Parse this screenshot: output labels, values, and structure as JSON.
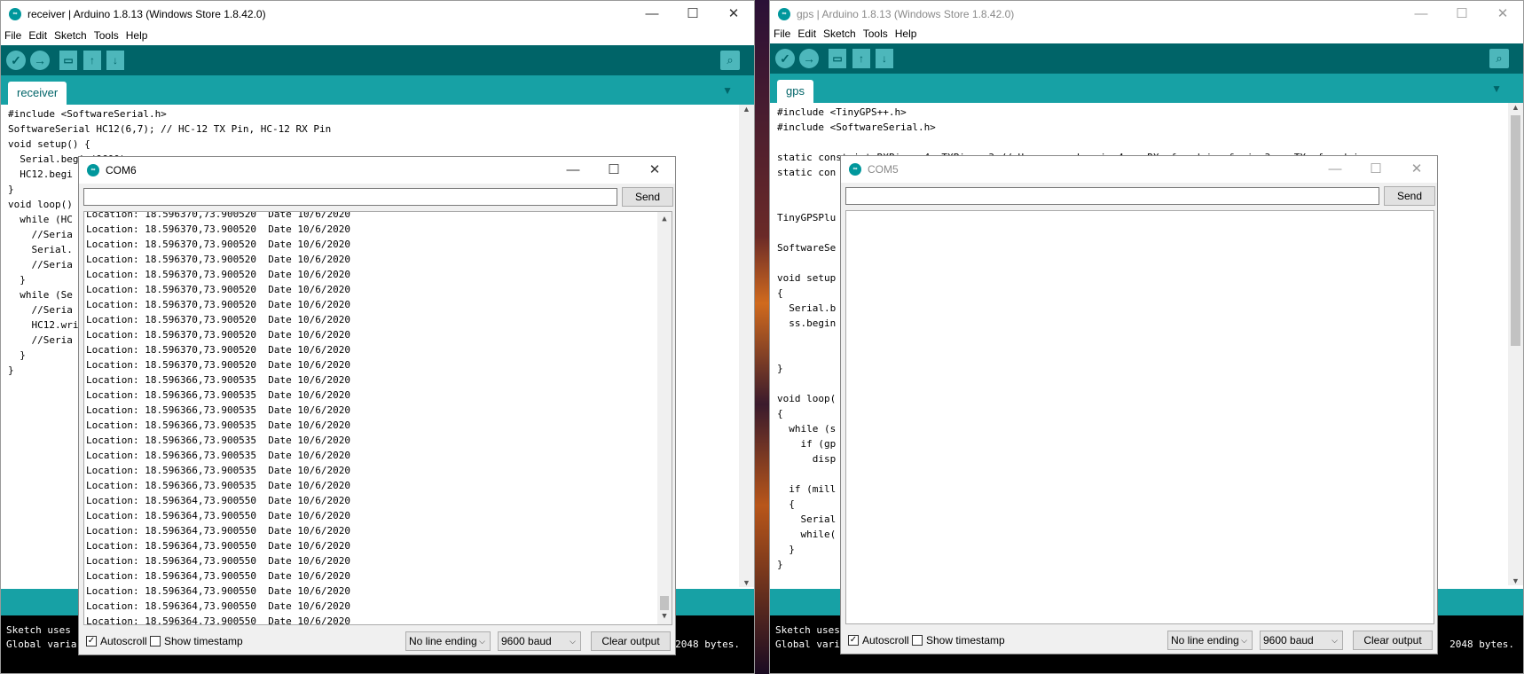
{
  "left_window": {
    "title": "receiver | Arduino 1.8.13 (Windows Store 1.8.42.0)",
    "menus": [
      "File",
      "Edit",
      "Sketch",
      "Tools",
      "Help"
    ],
    "tab": "receiver",
    "code_lines": [
      "#include <SoftwareSerial.h>",
      "SoftwareSerial HC12(6,7); // HC-12 TX Pin, HC-12 RX Pin",
      "void setup() {",
      "  Serial.begin(9600);",
      "  HC12.begi",
      "}",
      "void loop()",
      "  while (HC",
      "    //Seria",
      "    Serial.",
      "    //Seria",
      "  }",
      "  while (Se",
      "    //Seria",
      "    HC12.wri",
      "    //Seria",
      "  }",
      "}"
    ],
    "console_lines": [
      "Sketch uses",
      "Global varia"
    ]
  },
  "left_serial": {
    "title": "COM6",
    "send_label": "Send",
    "output_lines": [
      "Location: 18.596370,73.900520  Date 10/6/2020",
      "Location: 18.596370,73.900520  Date 10/6/2020",
      "Location: 18.596370,73.900520  Date 10/6/2020",
      "Location: 18.596370,73.900520  Date 10/6/2020",
      "Location: 18.596370,73.900520  Date 10/6/2020",
      "Location: 18.596370,73.900520  Date 10/6/2020",
      "Location: 18.596370,73.900520  Date 10/6/2020",
      "Location: 18.596370,73.900520  Date 10/6/2020",
      "Location: 18.596370,73.900520  Date 10/6/2020",
      "Location: 18.596370,73.900520  Date 10/6/2020",
      "Location: 18.596370,73.900520  Date 10/6/2020",
      "Location: 18.596366,73.900535  Date 10/6/2020",
      "Location: 18.596366,73.900535  Date 10/6/2020",
      "Location: 18.596366,73.900535  Date 10/6/2020",
      "Location: 18.596366,73.900535  Date 10/6/2020",
      "Location: 18.596366,73.900535  Date 10/6/2020",
      "Location: 18.596366,73.900535  Date 10/6/2020",
      "Location: 18.596366,73.900535  Date 10/6/2020",
      "Location: 18.596366,73.900535  Date 10/6/2020",
      "Location: 18.596364,73.900550  Date 10/6/2020",
      "Location: 18.596364,73.900550  Date 10/6/2020",
      "Location: 18.596364,73.900550  Date 10/6/2020",
      "Location: 18.596364,73.900550  Date 10/6/2020",
      "Location: 18.596364,73.900550  Date 10/6/2020",
      "Location: 18.596364,73.900550  Date 10/6/2020",
      "Location: 18.596364,73.900550  Date 10/6/2020",
      "Location: 18.596364,73.900550  Date 10/6/2020",
      "Location: 18.596364,73.900550  Date 10/6/2020"
    ],
    "autoscroll_label": "Autoscroll",
    "autoscroll_checked": true,
    "timestamp_label": "Show timestamp",
    "line_ending": "No line ending",
    "baud": "9600 baud",
    "clear_label": "Clear output"
  },
  "right_window": {
    "title": "gps | Arduino 1.8.13 (Windows Store 1.8.42.0)",
    "menus": [
      "File",
      "Edit",
      "Sketch",
      "Tools",
      "Help"
    ],
    "tab": "gps",
    "code_lines": [
      "#include <TinyGPS++.h>",
      "#include <SoftwareSerial.h>",
      "",
      "static const int RXPin = 4, TXPin = 3;// Here we make pin 4 as RX of arduino & pin 3 as TX of arduino",
      "static con",
      "",
      "",
      "TinyGPSPlu",
      "",
      "SoftwareSe",
      "",
      "void setup",
      "{",
      "  Serial.b",
      "  ss.begin",
      "",
      "",
      "}",
      "",
      "void loop(",
      "{",
      "  while (s",
      "    if (gp",
      "      disp",
      "",
      "  if (mill",
      "  {",
      "    Serial",
      "    while(",
      "  }",
      "}"
    ],
    "console_lines": [
      "Sketch uses",
      "Global vari"
    ],
    "console_right_text": "2048 bytes."
  },
  "right_serial": {
    "title": "COM5",
    "send_label": "Send",
    "autoscroll_label": "Autoscroll",
    "autoscroll_checked": true,
    "timestamp_label": "Show timestamp",
    "line_ending": "No line ending",
    "baud": "9600 baud",
    "clear_label": "Clear output"
  },
  "left_console_right_text": "2048 bytes.",
  "colors": {
    "toolbar": "#006468",
    "tabbar": "#17a1a5",
    "keyword": "#00979c",
    "type": "#cc6633",
    "comment": "#95a5a6"
  }
}
